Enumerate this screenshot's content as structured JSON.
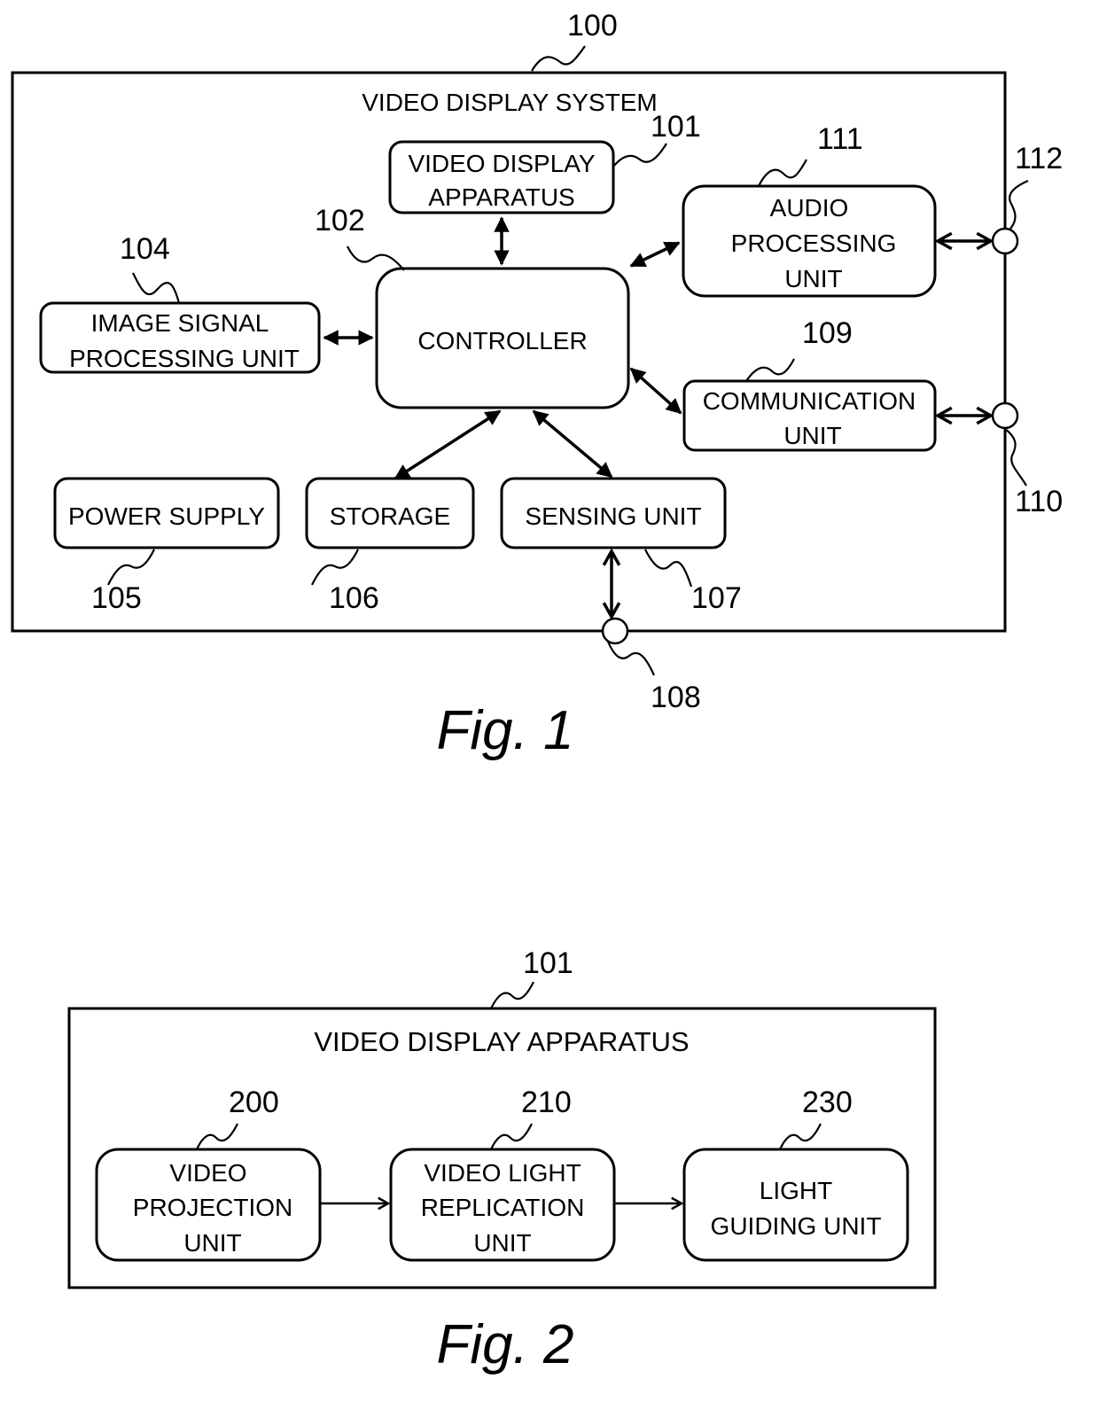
{
  "figures": [
    {
      "caption": "Fig. 1",
      "system": {
        "ref": "100",
        "title": "VIDEO DISPLAY SYSTEM"
      },
      "blocks": {
        "video_display_apparatus": {
          "ref": "101",
          "lines": [
            "VIDEO DISPLAY",
            "APPARATUS"
          ]
        },
        "controller": {
          "ref": "102",
          "lines": [
            "CONTROLLER"
          ]
        },
        "image_signal_processing_unit": {
          "ref": "104",
          "lines": [
            "IMAGE SIGNAL",
            "PROCESSING UNIT"
          ]
        },
        "power_supply": {
          "ref": "105",
          "lines": [
            "POWER SUPPLY"
          ]
        },
        "storage": {
          "ref": "106",
          "lines": [
            "STORAGE"
          ]
        },
        "sensing_unit": {
          "ref": "107",
          "lines": [
            "SENSING UNIT"
          ]
        },
        "communication_unit": {
          "ref": "109",
          "lines": [
            "COMMUNICATION",
            "UNIT"
          ]
        },
        "audio_processing_unit": {
          "ref": "111",
          "lines": [
            "AUDIO",
            "PROCESSING",
            "UNIT"
          ]
        }
      },
      "terminals": {
        "sensing_terminal": {
          "ref": "108"
        },
        "communication_terminal": {
          "ref": "110"
        },
        "audio_terminal": {
          "ref": "112"
        }
      },
      "connections": [
        {
          "from": "controller",
          "to": "video_display_apparatus",
          "type": "bidirectional"
        },
        {
          "from": "controller",
          "to": "image_signal_processing_unit",
          "type": "bidirectional"
        },
        {
          "from": "controller",
          "to": "audio_processing_unit",
          "type": "bidirectional"
        },
        {
          "from": "controller",
          "to": "communication_unit",
          "type": "bidirectional"
        },
        {
          "from": "controller",
          "to": "storage",
          "type": "bidirectional"
        },
        {
          "from": "controller",
          "to": "sensing_unit",
          "type": "bidirectional"
        },
        {
          "from": "sensing_unit",
          "to": "sensing_terminal",
          "type": "bidirectional"
        },
        {
          "from": "communication_unit",
          "to": "communication_terminal",
          "type": "bidirectional"
        },
        {
          "from": "audio_processing_unit",
          "to": "audio_terminal",
          "type": "bidirectional"
        }
      ]
    },
    {
      "caption": "Fig. 2",
      "system": {
        "ref": "101",
        "title": "VIDEO DISPLAY APPARATUS"
      },
      "blocks": {
        "video_projection_unit": {
          "ref": "200",
          "lines": [
            "VIDEO",
            "PROJECTION",
            "UNIT"
          ]
        },
        "video_light_replication_unit": {
          "ref": "210",
          "lines": [
            "VIDEO LIGHT",
            "REPLICATION",
            "UNIT"
          ]
        },
        "light_guiding_unit": {
          "ref": "230",
          "lines": [
            "LIGHT",
            "GUIDING UNIT"
          ]
        }
      },
      "connections": [
        {
          "from": "video_projection_unit",
          "to": "video_light_replication_unit",
          "type": "directed"
        },
        {
          "from": "video_light_replication_unit",
          "to": "light_guiding_unit",
          "type": "directed"
        }
      ]
    }
  ]
}
